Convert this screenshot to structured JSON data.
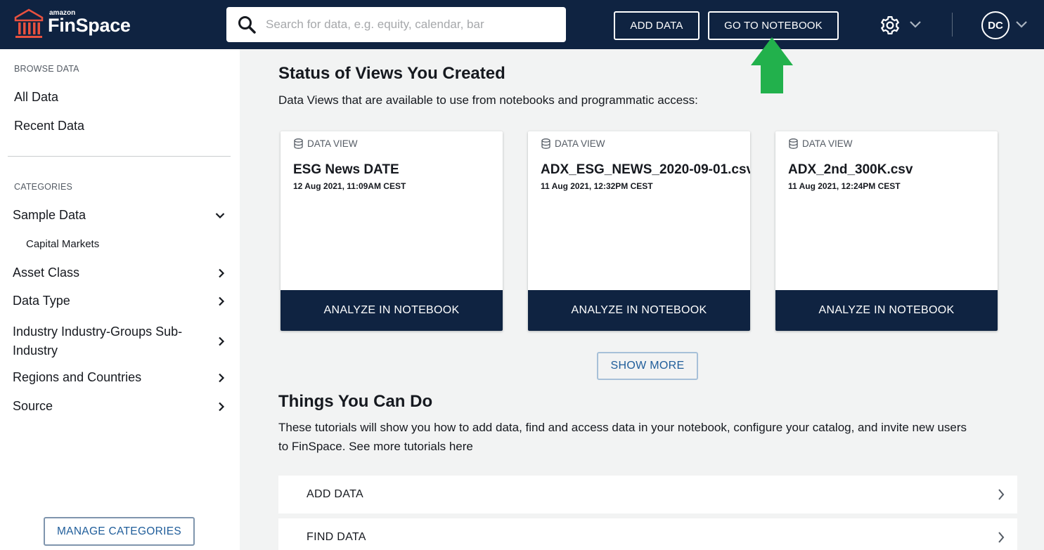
{
  "header": {
    "logo_small": "amazon",
    "logo_brand": "FinSpace",
    "search_placeholder": "Search for data, e.g. equity, calendar, bar",
    "add_data_label": "ADD DATA",
    "go_to_notebook_label": "GO TO NOTEBOOK",
    "settings_icon": "gear-icon",
    "user_initials": "DC"
  },
  "sidebar": {
    "browse_label": "BROWSE DATA",
    "browse_links": [
      "All Data",
      "Recent Data"
    ],
    "categories_label": "CATEGORIES",
    "categories": [
      {
        "label": "Sample Data",
        "expanded": true,
        "children": [
          "Capital Markets"
        ]
      },
      {
        "label": "Asset Class"
      },
      {
        "label": "Data Type"
      },
      {
        "label": "Industry Industry-Groups Sub-Industry"
      },
      {
        "label": "Regions and Countries"
      },
      {
        "label": "Source"
      }
    ],
    "manage_label": "MANAGE CATEGORIES"
  },
  "views": {
    "heading": "Status of Views You Created",
    "description": "Data Views that are available to use from notebooks and programmatic access:",
    "cards": [
      {
        "kind": "DATA VIEW",
        "title": "ESG News DATE",
        "date": "12 Aug 2021, 11:09AM CEST",
        "action": "ANALYZE IN NOTEBOOK"
      },
      {
        "kind": "DATA VIEW",
        "title": "ADX_ESG_NEWS_2020-09-01.csv",
        "date": "11 Aug 2021, 12:32PM CEST",
        "action": "ANALYZE IN NOTEBOOK"
      },
      {
        "kind": "DATA VIEW",
        "title": "ADX_2nd_300K.csv",
        "date": "11 Aug 2021, 12:24PM CEST",
        "action": "ANALYZE IN NOTEBOOK"
      }
    ],
    "show_more_label": "SHOW MORE"
  },
  "things": {
    "heading": "Things You Can Do",
    "description": "These tutorials will show you how to add data, find and access data in your notebook, configure your catalog, and invite new users to FinSpace. See more tutorials here",
    "tasks": [
      "ADD DATA",
      "FIND DATA"
    ]
  },
  "colors": {
    "navy": "#0f2341",
    "accent_red": "#e8513f",
    "arrow_green": "#22b14c",
    "link_blue": "#1f5d9a"
  }
}
